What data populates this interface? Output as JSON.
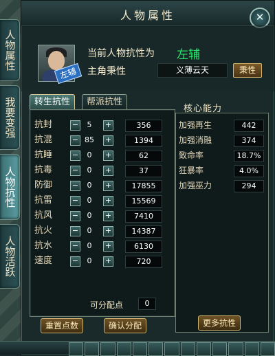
{
  "window": {
    "title": "人物属性"
  },
  "side_tabs": [
    {
      "label": "人物属性"
    },
    {
      "label": "我要变强"
    },
    {
      "label": "人物抗性"
    },
    {
      "label": "人物活跃"
    }
  ],
  "header": {
    "current_resist_label": "当前人物抗性为",
    "current_resist_value": "左辅",
    "hero_label": "主角秉性",
    "hero_value": "义薄云天",
    "hero_button": "秉性",
    "avatar_badge": "左辅"
  },
  "tabs": [
    {
      "label": "转生抗性"
    },
    {
      "label": "帮派抗性"
    }
  ],
  "resist_stats": [
    {
      "label": "抗封",
      "value": "5",
      "total": "356"
    },
    {
      "label": "抗混",
      "value": "85",
      "total": "1394"
    },
    {
      "label": "抗睡",
      "value": "0",
      "total": "62"
    },
    {
      "label": "抗毒",
      "value": "0",
      "total": "37"
    },
    {
      "label": "防御",
      "value": "0",
      "total": "17855"
    },
    {
      "label": "抗雷",
      "value": "0",
      "total": "15569"
    },
    {
      "label": "抗风",
      "value": "0",
      "total": "7410"
    },
    {
      "label": "抗火",
      "value": "0",
      "total": "14387"
    },
    {
      "label": "抗水",
      "value": "0",
      "total": "6130"
    },
    {
      "label": "速度",
      "value": "0",
      "total": "720"
    }
  ],
  "core": {
    "title": "核心能力",
    "stats": [
      {
        "label": "加强再生",
        "value": "442"
      },
      {
        "label": "加强消融",
        "value": "374"
      },
      {
        "label": "致命率",
        "value": "18.7%"
      },
      {
        "label": "狂暴率",
        "value": "4.0%"
      },
      {
        "label": "加强巫力",
        "value": "294"
      }
    ],
    "more_button": "更多抗性"
  },
  "allocation": {
    "label": "可分配点",
    "value": "0",
    "reset_button": "重置点数",
    "confirm_button": "确认分配"
  }
}
